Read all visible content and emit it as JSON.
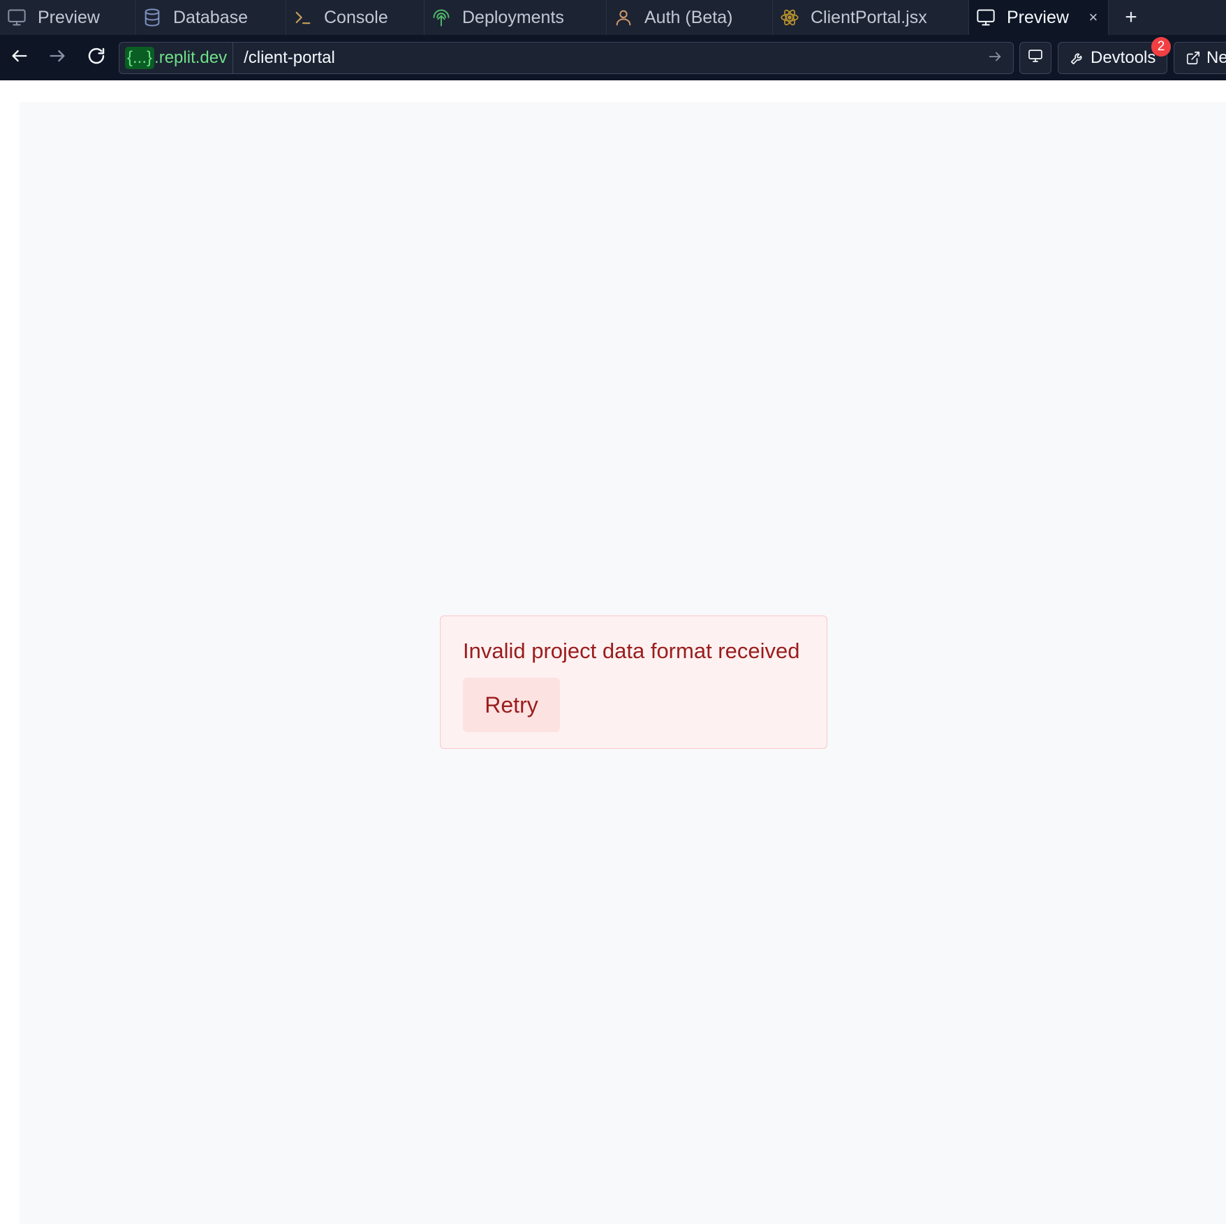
{
  "tabs": [
    {
      "label": "Preview",
      "icon": "monitor-icon"
    },
    {
      "label": "Database",
      "icon": "database-icon"
    },
    {
      "label": "Console",
      "icon": "terminal-icon"
    },
    {
      "label": "Deployments",
      "icon": "deployments-icon"
    },
    {
      "label": "Auth (Beta)",
      "icon": "user-icon"
    },
    {
      "label": "ClientPortal.jsx",
      "icon": "react-icon"
    },
    {
      "label": "Preview",
      "icon": "monitor-icon",
      "active": true,
      "close_glyph": "×"
    }
  ],
  "add_tab_glyph": "+",
  "address": {
    "host_brace": "{...}",
    "host_domain": ".replit.dev",
    "path": "/client-portal"
  },
  "toolbar": {
    "devtools_label": "Devtools",
    "devtools_badge": "2",
    "new_tab_label": "Ne"
  },
  "error": {
    "message": "Invalid project data format received",
    "retry_label": "Retry"
  },
  "colors": {
    "chrome_bg": "#1c2333",
    "active_tab_bg": "#0e1525",
    "domain_green": "#6ee087",
    "badge_red": "#f23f42",
    "error_text": "#9b1c1c",
    "error_bg": "#fef1f1",
    "retry_bg": "#fde2e2"
  }
}
